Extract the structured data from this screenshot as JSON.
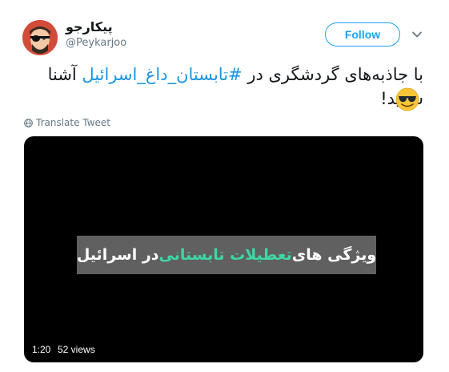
{
  "author": {
    "display_name": "پیکارجو",
    "username": "@Peykarjoo"
  },
  "follow_label": "Follow",
  "tweet": {
    "text_before": "با جاذبه‌های گردشگری در ",
    "hashtag": "#تابستان_داغ_اسرائیل",
    "text_after": " آشنا شوید!",
    "emoji_icon": "sunglasses-emoji-icon"
  },
  "translate_label": "Translate Tweet",
  "video": {
    "caption_before": "ویژگی های ",
    "caption_highlight": "تعطیلات تابستانی",
    "caption_after": " در اسرائیل",
    "duration": "1:20",
    "views": "52 views"
  },
  "colors": {
    "accent": "#1da1f2",
    "hashtag": "#1b95e0",
    "caption_highlight": "#3fd6a6",
    "avatar_bg": "#d24c3a"
  }
}
